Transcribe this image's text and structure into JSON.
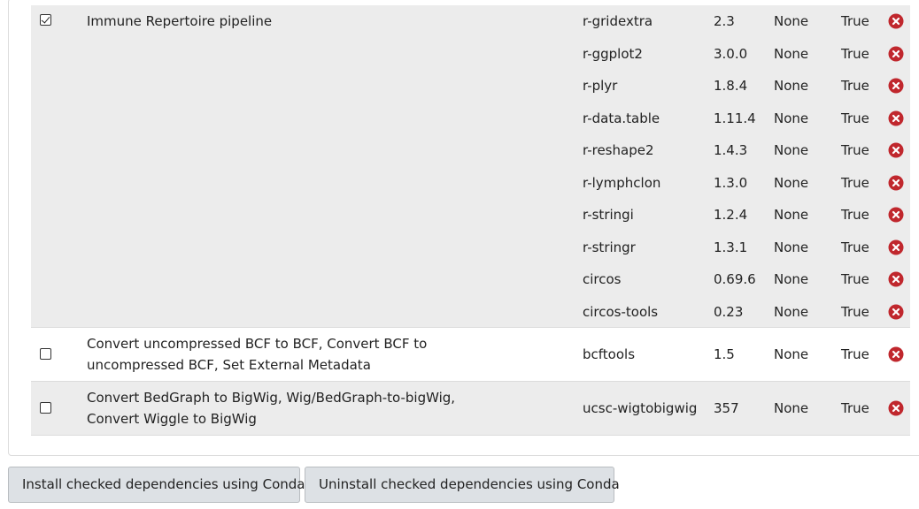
{
  "groups": [
    {
      "checked": true,
      "tool": "Immune Repertoire pipeline",
      "deps": [
        {
          "name": "r-gridextra",
          "version": "2.3",
          "channel": "None",
          "installed": "True"
        },
        {
          "name": "r-ggplot2",
          "version": "3.0.0",
          "channel": "None",
          "installed": "True"
        },
        {
          "name": "r-plyr",
          "version": "1.8.4",
          "channel": "None",
          "installed": "True"
        },
        {
          "name": "r-data.table",
          "version": "1.11.4",
          "channel": "None",
          "installed": "True"
        },
        {
          "name": "r-reshape2",
          "version": "1.4.3",
          "channel": "None",
          "installed": "True"
        },
        {
          "name": "r-lymphclon",
          "version": "1.3.0",
          "channel": "None",
          "installed": "True"
        },
        {
          "name": "r-stringi",
          "version": "1.2.4",
          "channel": "None",
          "installed": "True"
        },
        {
          "name": "r-stringr",
          "version": "1.3.1",
          "channel": "None",
          "installed": "True"
        },
        {
          "name": "circos",
          "version": "0.69.6",
          "channel": "None",
          "installed": "True"
        },
        {
          "name": "circos-tools",
          "version": "0.23",
          "channel": "None",
          "installed": "True"
        }
      ]
    },
    {
      "checked": false,
      "tool": "Convert uncompressed BCF to BCF, Convert BCF to uncompressed BCF, Set External Metadata",
      "deps": [
        {
          "name": "bcftools",
          "version": "1.5",
          "channel": "None",
          "installed": "True"
        }
      ]
    },
    {
      "checked": false,
      "tool": "Convert BedGraph to BigWig, Wig/BedGraph-to-bigWig, Convert Wiggle to BigWig",
      "deps": [
        {
          "name": "ucsc-wigtobigwig",
          "version": "357",
          "channel": "None",
          "installed": "True"
        }
      ]
    }
  ],
  "buttons": {
    "install": "Install checked dependencies using Conda",
    "uninstall": "Uninstall checked dependencies using Conda"
  },
  "icons": {
    "remove": "remove-circle-x-icon"
  },
  "colors": {
    "shaded_row": "#ececec",
    "remove_icon": "#c0272d",
    "button_bg": "#dde1e5"
  }
}
